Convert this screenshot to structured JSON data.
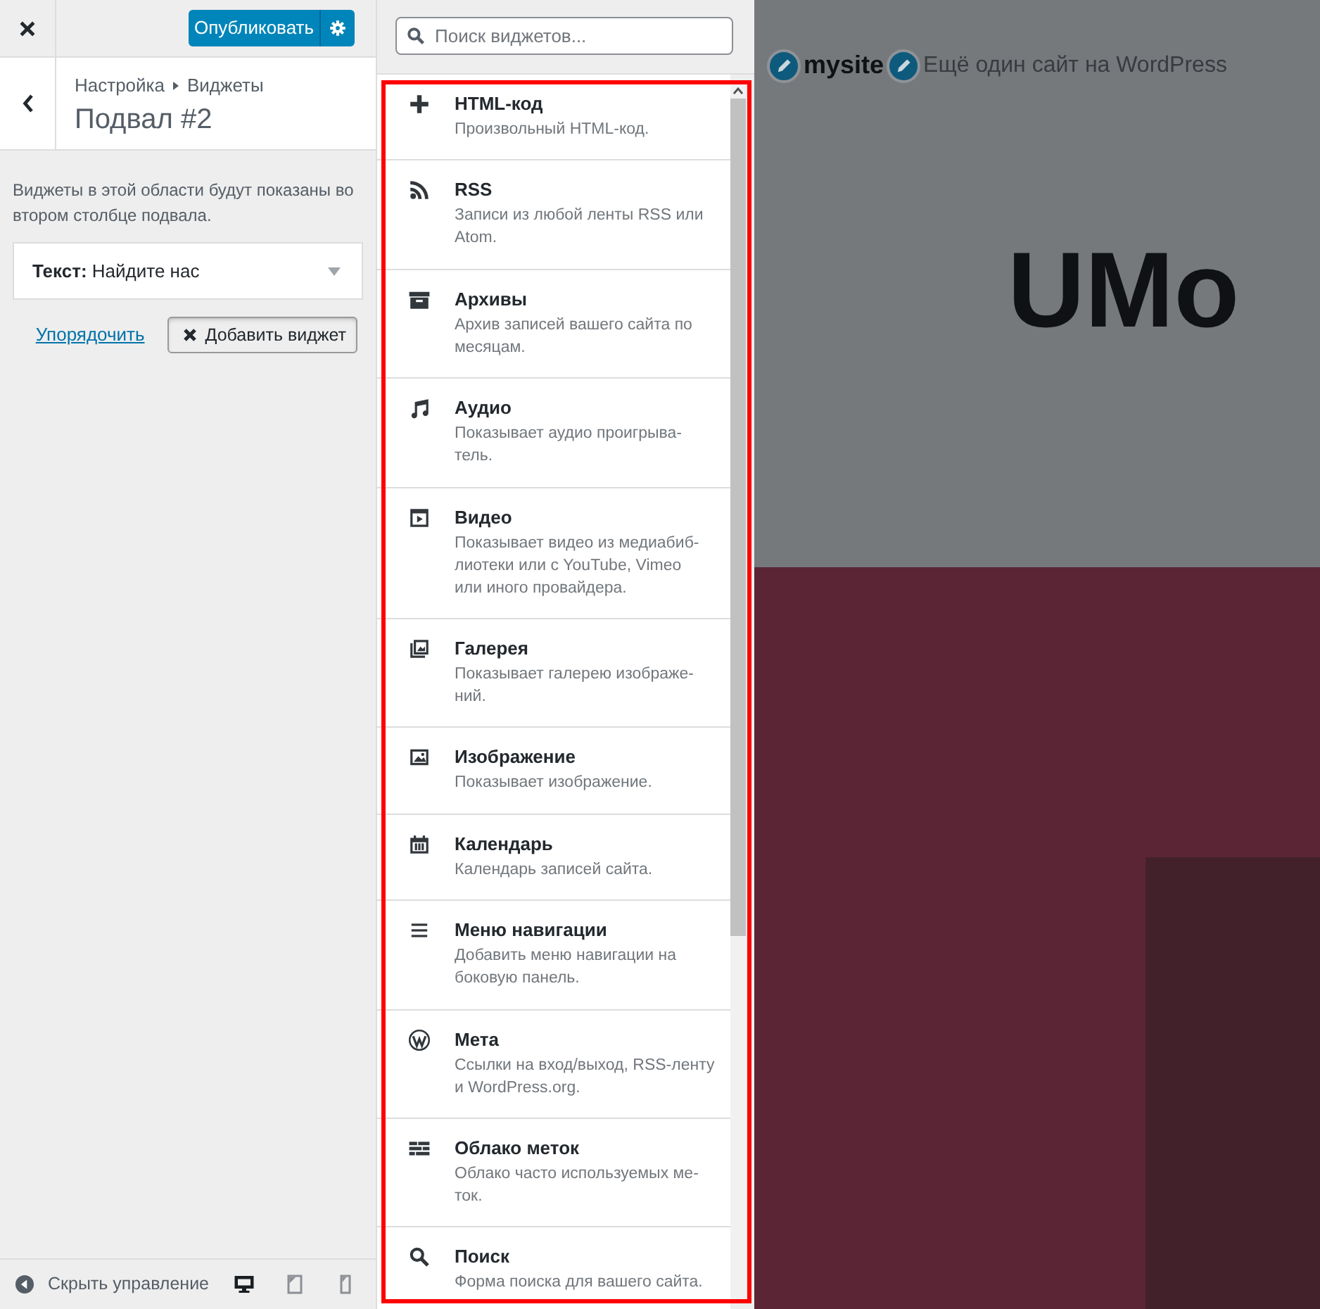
{
  "customizer": {
    "publish_button": "Опубликовать",
    "section": {
      "breadcrumb": [
        "Настройка",
        "Виджеты"
      ],
      "title": "Подвал #2"
    },
    "description": "Виджеты в этой области будут показаны во\nвтором столбце подвала.",
    "widgets": [
      {
        "title": "**Текст:** Найдите нас",
        "expanded": false
      }
    ],
    "reorder_link": "Упорядочить",
    "add_widget_button": {
      "label": "Добавить виджет",
      "panel_open": true
    },
    "footer": {
      "collapse_label": "Скрыть управление",
      "devices": [
        {
          "kind": "desktop",
          "selected": true
        },
        {
          "kind": "tablet",
          "selected": false
        },
        {
          "kind": "mobile",
          "selected": false
        }
      ]
    }
  },
  "widget_panel": {
    "search": {
      "placeholder": "Поиск виджетов..."
    },
    "widgets": [
      {
        "kind": "html",
        "title": "HTML-код",
        "description": "Произвольный HTML-код."
      },
      {
        "kind": "rss",
        "title": "RSS",
        "description": "Записи из любой ленты RSS или\nAtom."
      },
      {
        "kind": "archive",
        "title": "Архивы",
        "description": "Архив записей вашего сайта по\nмесяцам."
      },
      {
        "kind": "audio",
        "title": "Аудио",
        "description": "Показывает аудио проигрыва-\nтель."
      },
      {
        "kind": "video",
        "title": "Видео",
        "description": "Показывает видео из медиабиб-\nлиотеки или с YouTube, Vimeo\nили иного провайдера."
      },
      {
        "kind": "gallery",
        "title": "Галерея",
        "description": "Показывает галерею изображе-\nний."
      },
      {
        "kind": "image",
        "title": "Изображение",
        "description": "Показывает изображение."
      },
      {
        "kind": "calendar",
        "title": "Календарь",
        "description": "Календарь записей сайта."
      },
      {
        "kind": "menu",
        "title": "Меню навигации",
        "description": "Добавить меню навигации на\nбоковую панель."
      },
      {
        "kind": "meta",
        "title": "Мета",
        "description": "Ссылки на вход/выход, RSS-ленту\nи WordPress.org."
      },
      {
        "kind": "tagcloud",
        "title": "Облако меток",
        "description": "Облако часто используемых ме-\nток."
      },
      {
        "kind": "search",
        "title": "Поиск",
        "description": "Форма поиска для вашего сайта."
      }
    ]
  },
  "preview": {
    "site_title": "mysite",
    "tagline": "Ещё один сайт на WordPress",
    "heading": "UMo"
  }
}
